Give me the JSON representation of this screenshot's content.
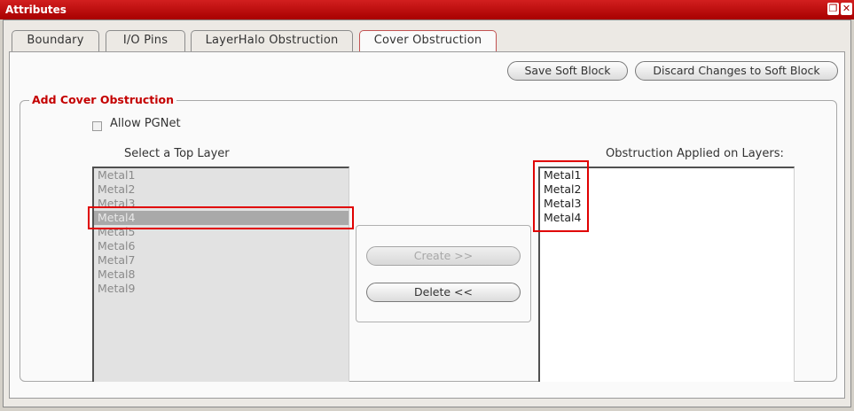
{
  "window": {
    "title": "Attributes",
    "restore_icon": "restore-icon",
    "close_icon": "close-icon"
  },
  "tabs": [
    {
      "label": "Boundary",
      "active": false
    },
    {
      "label": "I/O Pins",
      "active": false
    },
    {
      "label": "LayerHalo Obstruction",
      "active": false
    },
    {
      "label": "Cover Obstruction",
      "active": true
    }
  ],
  "toolbar": {
    "save_label": "Save Soft Block",
    "discard_label": "Discard Changes to Soft Block"
  },
  "group": {
    "title": "Add Cover Obstruction",
    "allow_pgnet": {
      "label": "Allow PGNet",
      "checked": false
    },
    "top_layer": {
      "label": "Select a Top Layer",
      "items": [
        "Metal1",
        "Metal2",
        "Metal3",
        "Metal4",
        "Metal5",
        "Metal6",
        "Metal7",
        "Metal8",
        "Metal9"
      ],
      "selected": "Metal4"
    },
    "actions": {
      "create_label": "Create >>",
      "delete_label": "Delete <<"
    },
    "applied": {
      "label": "Obstruction Applied on Layers:",
      "items": [
        "Metal1",
        "Metal2",
        "Metal3",
        "Metal4"
      ]
    }
  },
  "colors": {
    "titlebar": "#b40000",
    "legend": "#c40000",
    "highlight": "#e00000"
  }
}
